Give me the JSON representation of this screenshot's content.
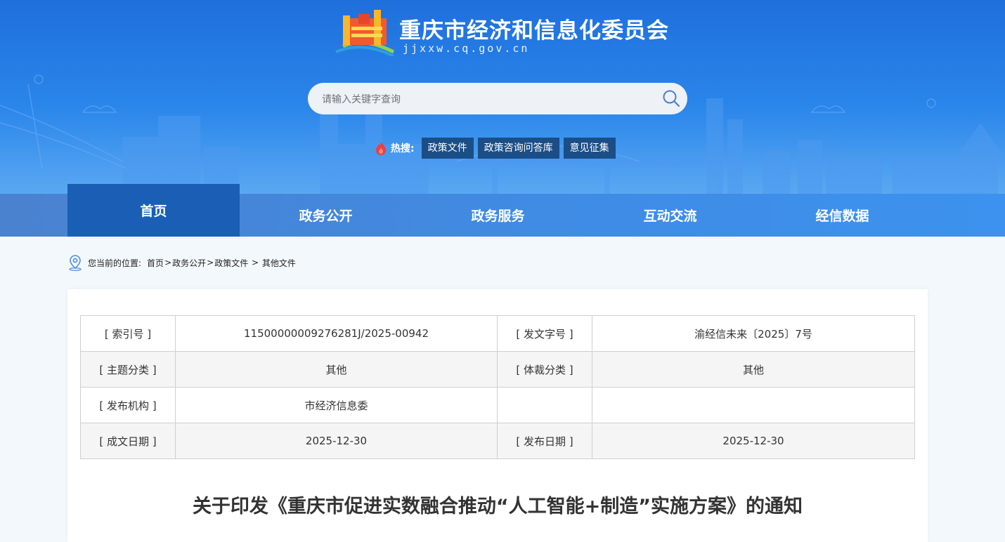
{
  "site": {
    "title": "重庆市经济和信息化委员会",
    "domain": "jjxxw.cq.gov.cn"
  },
  "search": {
    "placeholder": "请输入关键字查询",
    "hot_label": "热搜:",
    "hot_tags": [
      "政策文件",
      "政策咨询问答库",
      "意见征集"
    ]
  },
  "nav": {
    "items": [
      "首页",
      "政务公开",
      "政务服务",
      "互动交流",
      "经信数据"
    ],
    "active": "首页"
  },
  "breadcrumb": {
    "label": "您当前的位置:",
    "items": [
      "首页",
      "政务公开",
      "政策文件",
      "其他文件"
    ]
  },
  "meta_table": {
    "rows": [
      [
        "[ 索引号 ]",
        "11500000009276281J/2025-00942",
        "[ 发文字号 ]",
        "渝经信未来〔2025〕7号"
      ],
      [
        "[ 主题分类 ]",
        "其他",
        "[ 体裁分类 ]",
        "其他"
      ],
      [
        "[ 发布机构 ]",
        "市经济信息委",
        "",
        ""
      ],
      [
        "[ 成文日期 ]",
        "2025-12-30",
        "[ 发布日期 ]",
        "2025-12-30"
      ]
    ]
  },
  "article": {
    "title": "关于印发《重庆市促进实数融合推动“人工智能+制造”实施方案》的通知"
  },
  "colors": {
    "header_blue": "#2a86ea",
    "nav_active": "#1a5fb5",
    "hot_tag_bg": "#1b4e86"
  },
  "icons": [
    "logo-emblem",
    "search-icon",
    "fire-icon",
    "location-pin-icon"
  ]
}
